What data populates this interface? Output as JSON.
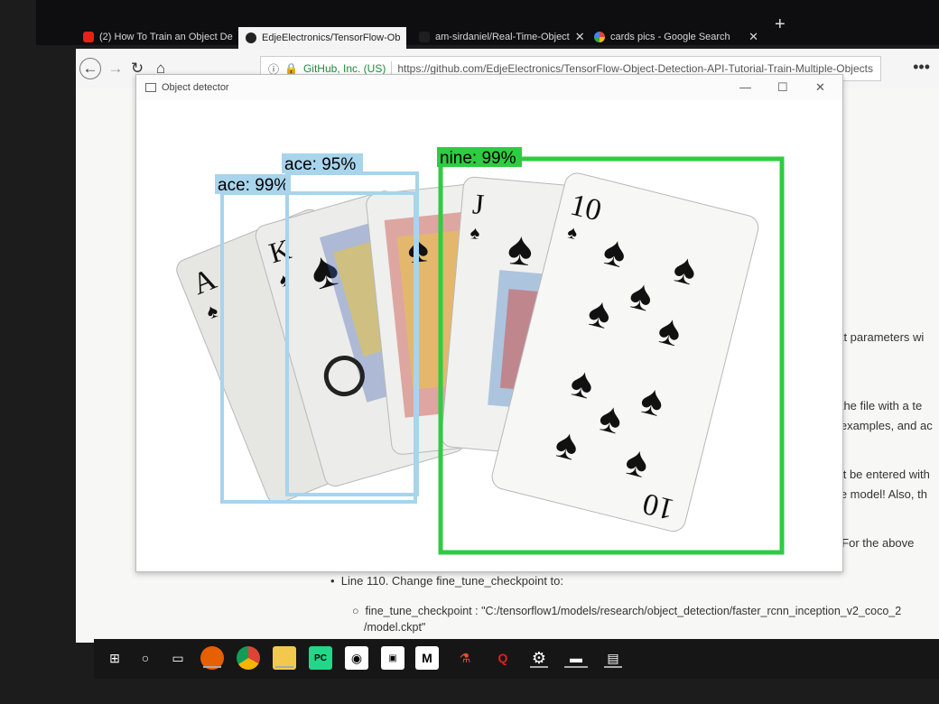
{
  "browser": {
    "tabs": [
      {
        "label": "(2) How To Train an Object De",
        "active": false,
        "icon": "youtube-icon"
      },
      {
        "label": "EdjeElectronics/TensorFlow-Ob",
        "active": true,
        "icon": "github-icon"
      },
      {
        "label": "am-sirdaniel/Real-Time-Object",
        "active": false,
        "icon": "github-icon"
      },
      {
        "label": "cards pics - Google Search",
        "active": false,
        "icon": "google-icon"
      }
    ],
    "new_tab": "+",
    "site_identity": "GitHub, Inc. (US)",
    "url": "https://github.com/EdjeElectronics/TensorFlow-Object-Detection-API-Tutorial-Train-Multiple-Objects",
    "menu": "•••"
  },
  "page": {
    "text_fragments": [
      "hat parameters wi",
      "n the file with a te",
      "d examples, and ac",
      "ust be entered with",
      "the model! Also, th",
      "tect. For the above"
    ],
    "bullet": "Line 110. Change fine_tune_checkpoint to:",
    "sub_bullet": "fine_tune_checkpoint : \"C:/tensorflow1/models/research/object_detection/faster_rcnn_inception_v2_coco_2",
    "sub_bullet_cont": "/model.ckpt\""
  },
  "detector_window": {
    "title": "Object detector",
    "detections": [
      {
        "label": "ace: 99%",
        "color": "#a8d4ec"
      },
      {
        "label": "ace: 95%",
        "color": "#a8d4ec"
      },
      {
        "label": "nine: 99%",
        "color": "#2ecc40"
      }
    ]
  },
  "taskbar": {
    "items": [
      "windows-start-icon",
      "cortana-icon",
      "task-view-icon",
      "firefox-icon",
      "chrome-icon",
      "file-explorer-icon",
      "pycharm-icon",
      "github-desktop-icon",
      "app-icon",
      "matlab-icon",
      "app-red-icon",
      "app-q-icon",
      "settings-icon",
      "window-icon",
      "window2-icon"
    ]
  }
}
